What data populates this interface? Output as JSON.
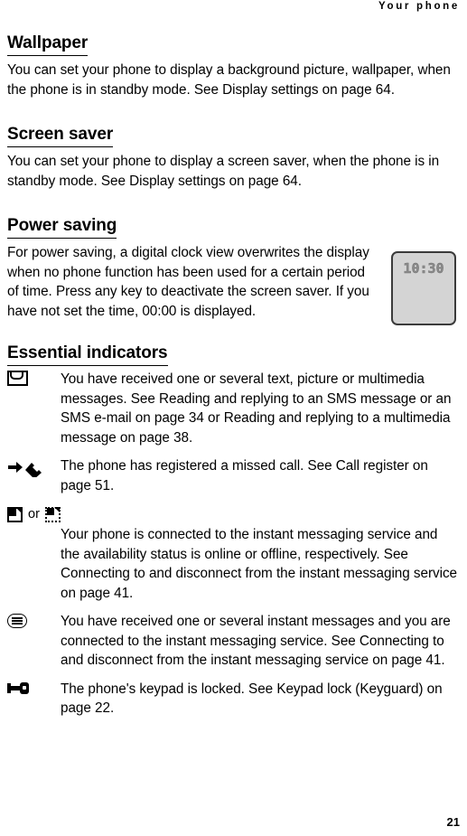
{
  "header": {
    "running_title": "Your phone"
  },
  "sections": [
    {
      "heading": "Wallpaper",
      "body": "You can set your phone to display a background picture, wallpaper, when the phone is in standby mode. See Display settings on page 64."
    },
    {
      "heading": "Screen saver",
      "body": "You can set your phone to display a screen saver, when the phone is in standby mode. See Display settings on page 64."
    },
    {
      "heading": "Power saving",
      "body": "For power saving, a digital clock view overwrites the display when no phone function has been used for a certain period of time. Press any key to deactivate the screen saver. If you have not set the time, 00:00 is displayed."
    }
  ],
  "figure": {
    "name": "digital-clock-screen",
    "clock_time": "10:30",
    "fill_color": "#d4d4d4",
    "border_color": "#3b3b3b",
    "digit_color": "#8b8b8b"
  },
  "indicators_section": {
    "heading": "Essential indicators",
    "or_word": "or",
    "items": [
      {
        "icon": "envelope-icon",
        "text": "You have received one or several text, picture or multimedia messages. See Reading and replying to an SMS message or an SMS e-mail on page 34 or Reading and replying to a multimedia message on page 38."
      },
      {
        "icon": "missed-call-icon",
        "text": "The phone has registered a missed call. See Call register on page 51."
      },
      {
        "icon": "im-online-icon",
        "icon_alt": "im-offline-icon",
        "text": "Your phone is connected to the instant messaging service and the availability status is online or offline, respectively. See Connecting to and disconnect from the instant messaging service on page 41."
      },
      {
        "icon": "im-message-icon",
        "text": "You have received one or several instant messages and you are connected to the instant messaging service. See Connecting to and disconnect from the instant messaging service on page 41."
      },
      {
        "icon": "keypad-lock-icon",
        "text": "The phone's keypad is locked. See Keypad lock (Keyguard) on page 22."
      }
    ]
  },
  "footer": {
    "page_number": "21"
  }
}
